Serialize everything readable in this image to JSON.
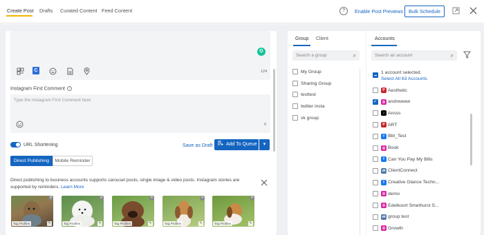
{
  "topbar": {
    "tabs": [
      {
        "label": "Create Post"
      },
      {
        "label": "Drafts"
      },
      {
        "label": "Curated Content"
      },
      {
        "label": "Feed Content"
      }
    ],
    "help_glyph": "?",
    "enable_previews": "Enable Post Previews",
    "bulk_schedule": "Bulk Schedule",
    "icons": [
      "help-icon",
      "export-icon",
      "close-icon"
    ]
  },
  "editor": {
    "char_count": "124",
    "icons": [
      "media-library-icon",
      "canva-icon",
      "emoji-icon",
      "document-icon",
      "location-icon",
      "grammarly-icon"
    ],
    "canva_letter": "C",
    "grammarly_letter": "G"
  },
  "first_comment": {
    "label": "Instagram First Comment",
    "placeholder": "Type the Instagram First Comment here",
    "char_count": "0"
  },
  "actions": {
    "url_shortening": "URL Shortening",
    "url_shortening_on": true,
    "save_as_draft": "Save as Draft",
    "add_to_queue": "Add To Queue"
  },
  "publishing_mode": {
    "options": [
      "Direct Publishing",
      "Mobile Reminder"
    ],
    "selected": "Direct Publishing"
  },
  "info": {
    "text": "Direct publishing to business accounts supports carousel posts, single image & video posts. Instagram stories are supported by reminders.",
    "link": "Learn More"
  },
  "media": {
    "tag_label": "Tag Profiles",
    "items": [
      {
        "name": "yorkie"
      },
      {
        "name": "samoyed"
      },
      {
        "name": "bulldog"
      },
      {
        "name": "basset"
      },
      {
        "name": "beagle"
      }
    ]
  },
  "groups": {
    "tabs": [
      "Group",
      "Client"
    ],
    "search_placeholder": "Search a group",
    "items": [
      "My Group",
      "Sharing Group",
      "testtest",
      "twitter insta",
      "vk group"
    ]
  },
  "accounts": {
    "tab": "Accounts",
    "search_placeholder": "Search an account",
    "selected_text": "1 account selected.",
    "select_all": "Select All 63 Accounts",
    "items": [
      {
        "name": "Aesthetic",
        "network": "P",
        "checked": false
      },
      {
        "name": "andrewww",
        "network": "IG",
        "checked": true
      },
      {
        "name": "Ansss",
        "network": "TT",
        "checked": false
      },
      {
        "name": "ART",
        "network": "P",
        "checked": false
      },
      {
        "name": "Bbt_Test",
        "network": "FB",
        "checked": false
      },
      {
        "name": "Book",
        "network": "IG",
        "checked": false
      },
      {
        "name": "Can You Pay My Bills",
        "network": "FB",
        "checked": false
      },
      {
        "name": "ClientConnect",
        "network": "VK",
        "checked": false
      },
      {
        "name": "Creative Glance Techn...",
        "network": "FB",
        "checked": false
      },
      {
        "name": "demo",
        "network": "IG",
        "checked": false
      },
      {
        "name": "Edelkoort Smethurst S...",
        "network": "IG",
        "checked": false
      },
      {
        "name": "group test",
        "network": "VK",
        "checked": false
      },
      {
        "name": "Growth",
        "network": "IG",
        "checked": false
      }
    ]
  },
  "colors": {
    "accent": "#1565c0",
    "tab_underline": "#f0b400",
    "pinterest": "#c8232c",
    "instagram": "#d6249f",
    "tiktok": "#000000",
    "facebook": "#1877f2",
    "vk": "#4a76a8"
  }
}
